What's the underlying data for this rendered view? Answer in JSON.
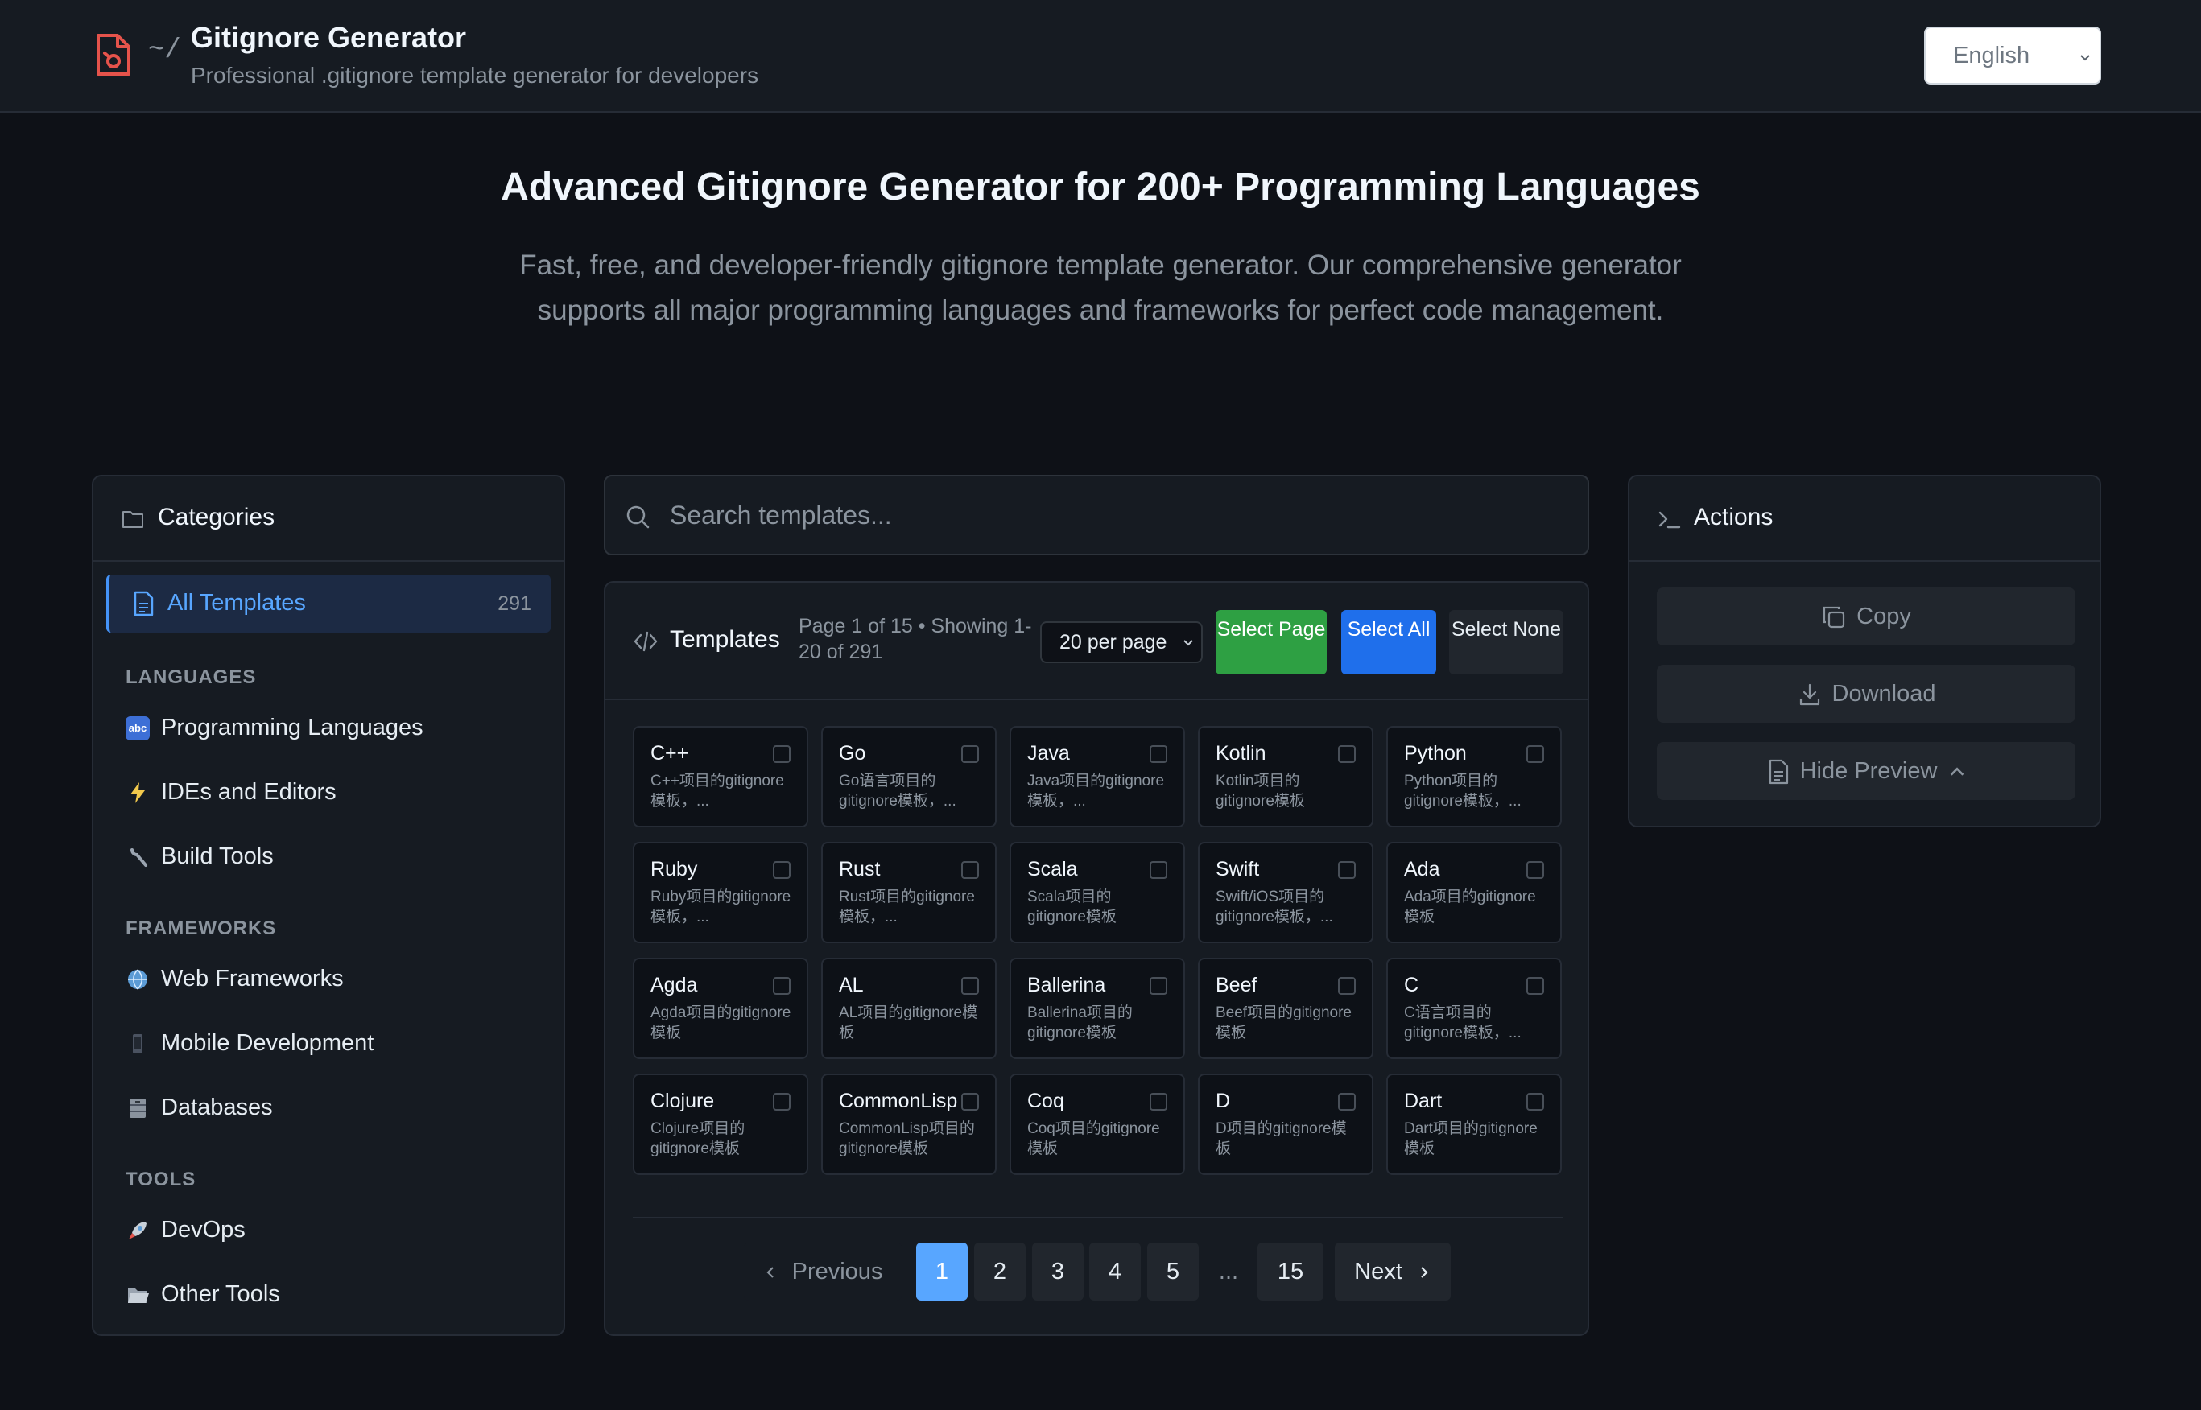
{
  "header": {
    "prefix": "~/",
    "title": "Gitignore Generator",
    "subtitle": "Professional .gitignore template generator for developers",
    "language": "English"
  },
  "hero": {
    "title": "Advanced Gitignore Generator for 200+ Programming Languages",
    "description": "Fast, free, and developer-friendly gitignore template generator. Our comprehensive generator supports all major programming languages and frameworks for perfect code management."
  },
  "categories": {
    "heading": "Categories",
    "all": {
      "label": "All Templates",
      "count": "291"
    },
    "sections": [
      {
        "label": "LANGUAGES",
        "items": [
          {
            "label": "Programming Languages",
            "icon": "abc-icon"
          },
          {
            "label": "IDEs and Editors",
            "icon": "lightning-icon"
          },
          {
            "label": "Build Tools",
            "icon": "wrench-icon"
          }
        ]
      },
      {
        "label": "FRAMEWORKS",
        "items": [
          {
            "label": "Web Frameworks",
            "icon": "globe-icon"
          },
          {
            "label": "Mobile Development",
            "icon": "phone-icon"
          },
          {
            "label": "Databases",
            "icon": "file-cabinet-icon"
          }
        ]
      },
      {
        "label": "TOOLS",
        "items": [
          {
            "label": "DevOps",
            "icon": "rocket-icon"
          },
          {
            "label": "Other Tools",
            "icon": "folder-icon"
          }
        ]
      }
    ]
  },
  "search": {
    "placeholder": "Search templates..."
  },
  "templates": {
    "heading": "Templates",
    "info": "Page 1 of 15 • Showing 1-20 of 291",
    "per_page": "20 per page",
    "select_page": "Select Page",
    "select_all": "Select All",
    "select_none": "Select None",
    "items": [
      {
        "name": "C++",
        "desc": "C++项目的gitignore模板，..."
      },
      {
        "name": "Go",
        "desc": "Go语言项目的gitignore模板，..."
      },
      {
        "name": "Java",
        "desc": "Java项目的gitignore模板，..."
      },
      {
        "name": "Kotlin",
        "desc": "Kotlin项目的gitignore模板"
      },
      {
        "name": "Python",
        "desc": "Python项目的gitignore模板，..."
      },
      {
        "name": "Ruby",
        "desc": "Ruby项目的gitignore模板，..."
      },
      {
        "name": "Rust",
        "desc": "Rust项目的gitignore模板，..."
      },
      {
        "name": "Scala",
        "desc": "Scala项目的gitignore模板"
      },
      {
        "name": "Swift",
        "desc": "Swift/iOS项目的gitignore模板，..."
      },
      {
        "name": "Ada",
        "desc": "Ada项目的gitignore模板"
      },
      {
        "name": "Agda",
        "desc": "Agda项目的gitignore模板"
      },
      {
        "name": "AL",
        "desc": "AL项目的gitignore模板"
      },
      {
        "name": "Ballerina",
        "desc": "Ballerina项目的gitignore模板"
      },
      {
        "name": "Beef",
        "desc": "Beef项目的gitignore模板"
      },
      {
        "name": "C",
        "desc": "C语言项目的gitignore模板，..."
      },
      {
        "name": "Clojure",
        "desc": "Clojure项目的gitignore模板"
      },
      {
        "name": "CommonLisp",
        "desc": "CommonLisp项目的gitignore模板"
      },
      {
        "name": "Coq",
        "desc": "Coq项目的gitignore模板"
      },
      {
        "name": "D",
        "desc": "D项目的gitignore模板"
      },
      {
        "name": "Dart",
        "desc": "Dart项目的gitignore模板"
      }
    ]
  },
  "pagination": {
    "previous": "Previous",
    "next": "Next",
    "pages": [
      "1",
      "2",
      "3",
      "4",
      "5",
      "...",
      "15"
    ],
    "current": "1"
  },
  "actions": {
    "heading": "Actions",
    "copy": "Copy",
    "download": "Download",
    "hide_preview": "Hide Preview"
  },
  "colors": {
    "background": "#0e1117",
    "panel": "#161b22",
    "accent": "#58a6ff",
    "select_page": "#2ea043",
    "select_all": "#1f6feb",
    "logo": "#e5534b"
  }
}
